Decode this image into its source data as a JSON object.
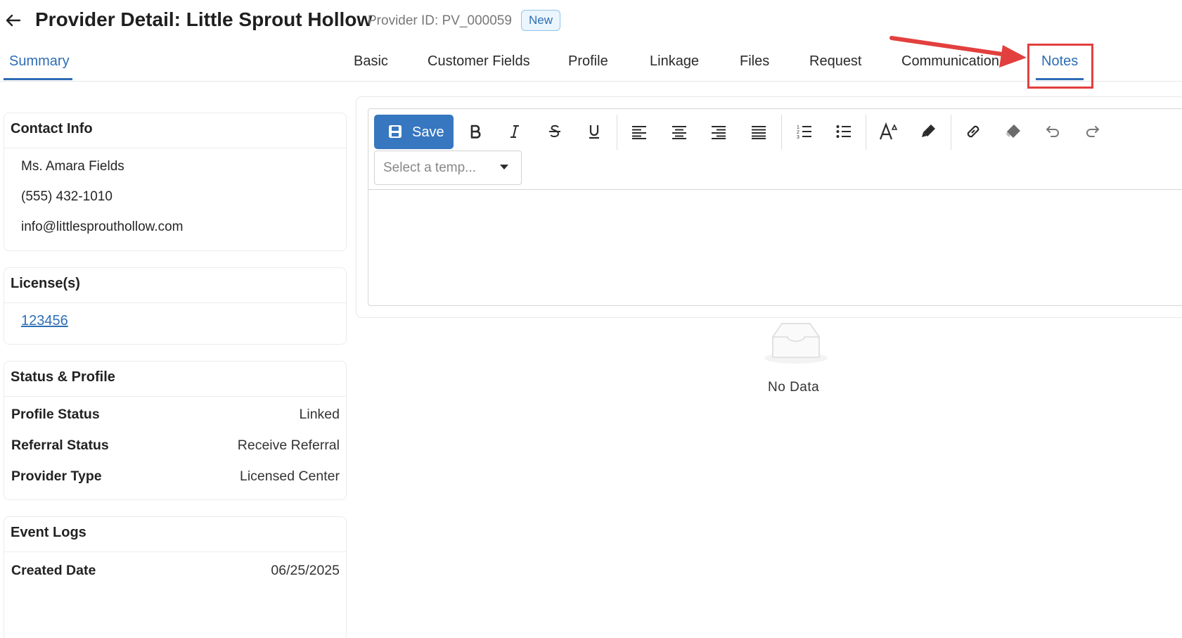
{
  "header": {
    "back_icon": "arrow-left-icon",
    "title": "Provider Detail: Little Sprout Hollow",
    "provider_id": "Provider ID: PV_000059",
    "status_badge": "New"
  },
  "tabs": {
    "summary": "Summary",
    "items": [
      "Basic",
      "Customer Fields",
      "Profile",
      "Linkage",
      "Files",
      "Request",
      "Communication",
      "Notes"
    ],
    "active": "Notes"
  },
  "contact_info": {
    "heading": "Contact Info",
    "name": "Ms. Amara Fields",
    "phone": "(555) 432-1010",
    "email": "info@littlesprouthollow.com"
  },
  "licenses": {
    "heading": "License(s)",
    "items": [
      "123456"
    ]
  },
  "status_profile": {
    "heading": "Status & Profile",
    "rows": [
      {
        "label": "Profile Status",
        "value": "Linked"
      },
      {
        "label": "Referral Status",
        "value": "Receive Referral"
      },
      {
        "label": "Provider Type",
        "value": "Licensed Center"
      }
    ]
  },
  "event_logs": {
    "heading": "Event Logs",
    "rows": [
      {
        "label": "Created Date",
        "value": "06/25/2025"
      }
    ]
  },
  "editor": {
    "save_label": "Save",
    "template_placeholder": "Select a temp...",
    "toolbar_icons": [
      "bold-icon",
      "italic-icon",
      "strikethrough-icon",
      "underline-icon",
      "align-left-icon",
      "align-center-icon",
      "align-right-icon",
      "align-justify-icon",
      "ordered-list-icon",
      "unordered-list-icon",
      "font-size-icon",
      "highlight-icon",
      "link-icon",
      "eraser-icon",
      "undo-icon",
      "redo-icon"
    ]
  },
  "empty_state": {
    "icon": "empty-inbox-icon",
    "text": "No Data"
  },
  "colors": {
    "accent": "#2e6db6",
    "save_button": "#3777c0",
    "annotation": "#e2403e"
  }
}
